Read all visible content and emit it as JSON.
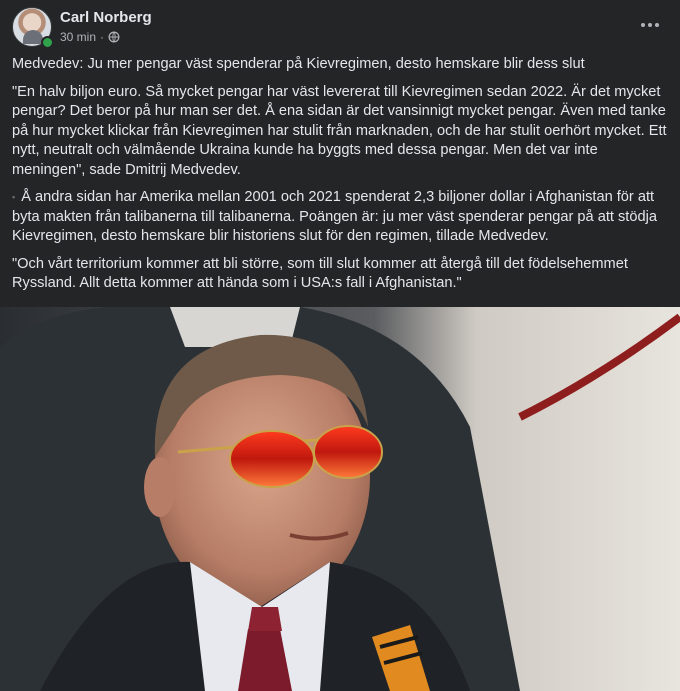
{
  "post": {
    "author": "Carl Norberg",
    "time": "30 min",
    "separator": "·",
    "more_icon": "more-horizontal-icon",
    "audience_icon": "globe-icon",
    "paragraphs": {
      "p0": "Medvedev: Ju mer pengar väst spenderar på Kievregimen, desto hemskare blir dess slut",
      "p1": "\"En halv biljon euro. Så mycket pengar har väst levererat till Kievregimen sedan 2022. Är det mycket pengar? Det beror på hur man ser det. Å ena sidan är det vansinnigt mycket pengar. Även med tanke på hur mycket klickar från Kievregimen har stulit från marknaden, och de har stulit oerhört mycket. Ett nytt, neutralt och välmående Ukraina kunde ha byggts med dessa pengar. Men det var inte meningen\", sade Dmitrij Medvedev.",
      "p2_bullet": "▪",
      "p2": " Å andra sidan har Amerika mellan 2001 och 2021 spenderat 2,3 biljoner dollar i Afghanistan för att byta makten från talibanerna till talibanerna. Poängen är: ju mer väst spenderar pengar på att stödja Kievregimen, desto hemskare blir historiens slut för den regimen, tillade Medvedev.",
      "p3": "\"Och vårt territorium kommer att bli större, som till slut kommer att återgå till det födelsehemmet Ryssland. Allt detta kommer att hända som i USA:s fall i Afghanistan.\""
    }
  },
  "colors": {
    "background": "#242526",
    "text_primary": "#e4e6eb",
    "text_secondary": "#b0b3b8",
    "online": "#31a24c"
  }
}
